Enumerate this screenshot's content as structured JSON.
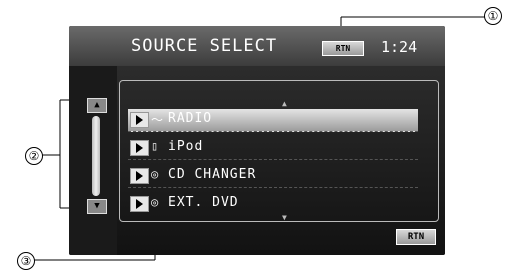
{
  "screen": {
    "title": "SOURCE SELECT",
    "rtn_top_label": "RTN",
    "clock": "1:24",
    "rtn_bottom_label": "RTN"
  },
  "sources": [
    {
      "label": "RADIO",
      "icon": "radio-icon",
      "selected": true
    },
    {
      "label": "iPod",
      "icon": "ipod-icon",
      "selected": false
    },
    {
      "label": "CD CHANGER",
      "icon": "cd-icon",
      "selected": false
    },
    {
      "label": "EXT. DVD",
      "icon": "dvd-icon",
      "selected": false
    }
  ],
  "callouts": [
    "①",
    "②",
    "③"
  ]
}
